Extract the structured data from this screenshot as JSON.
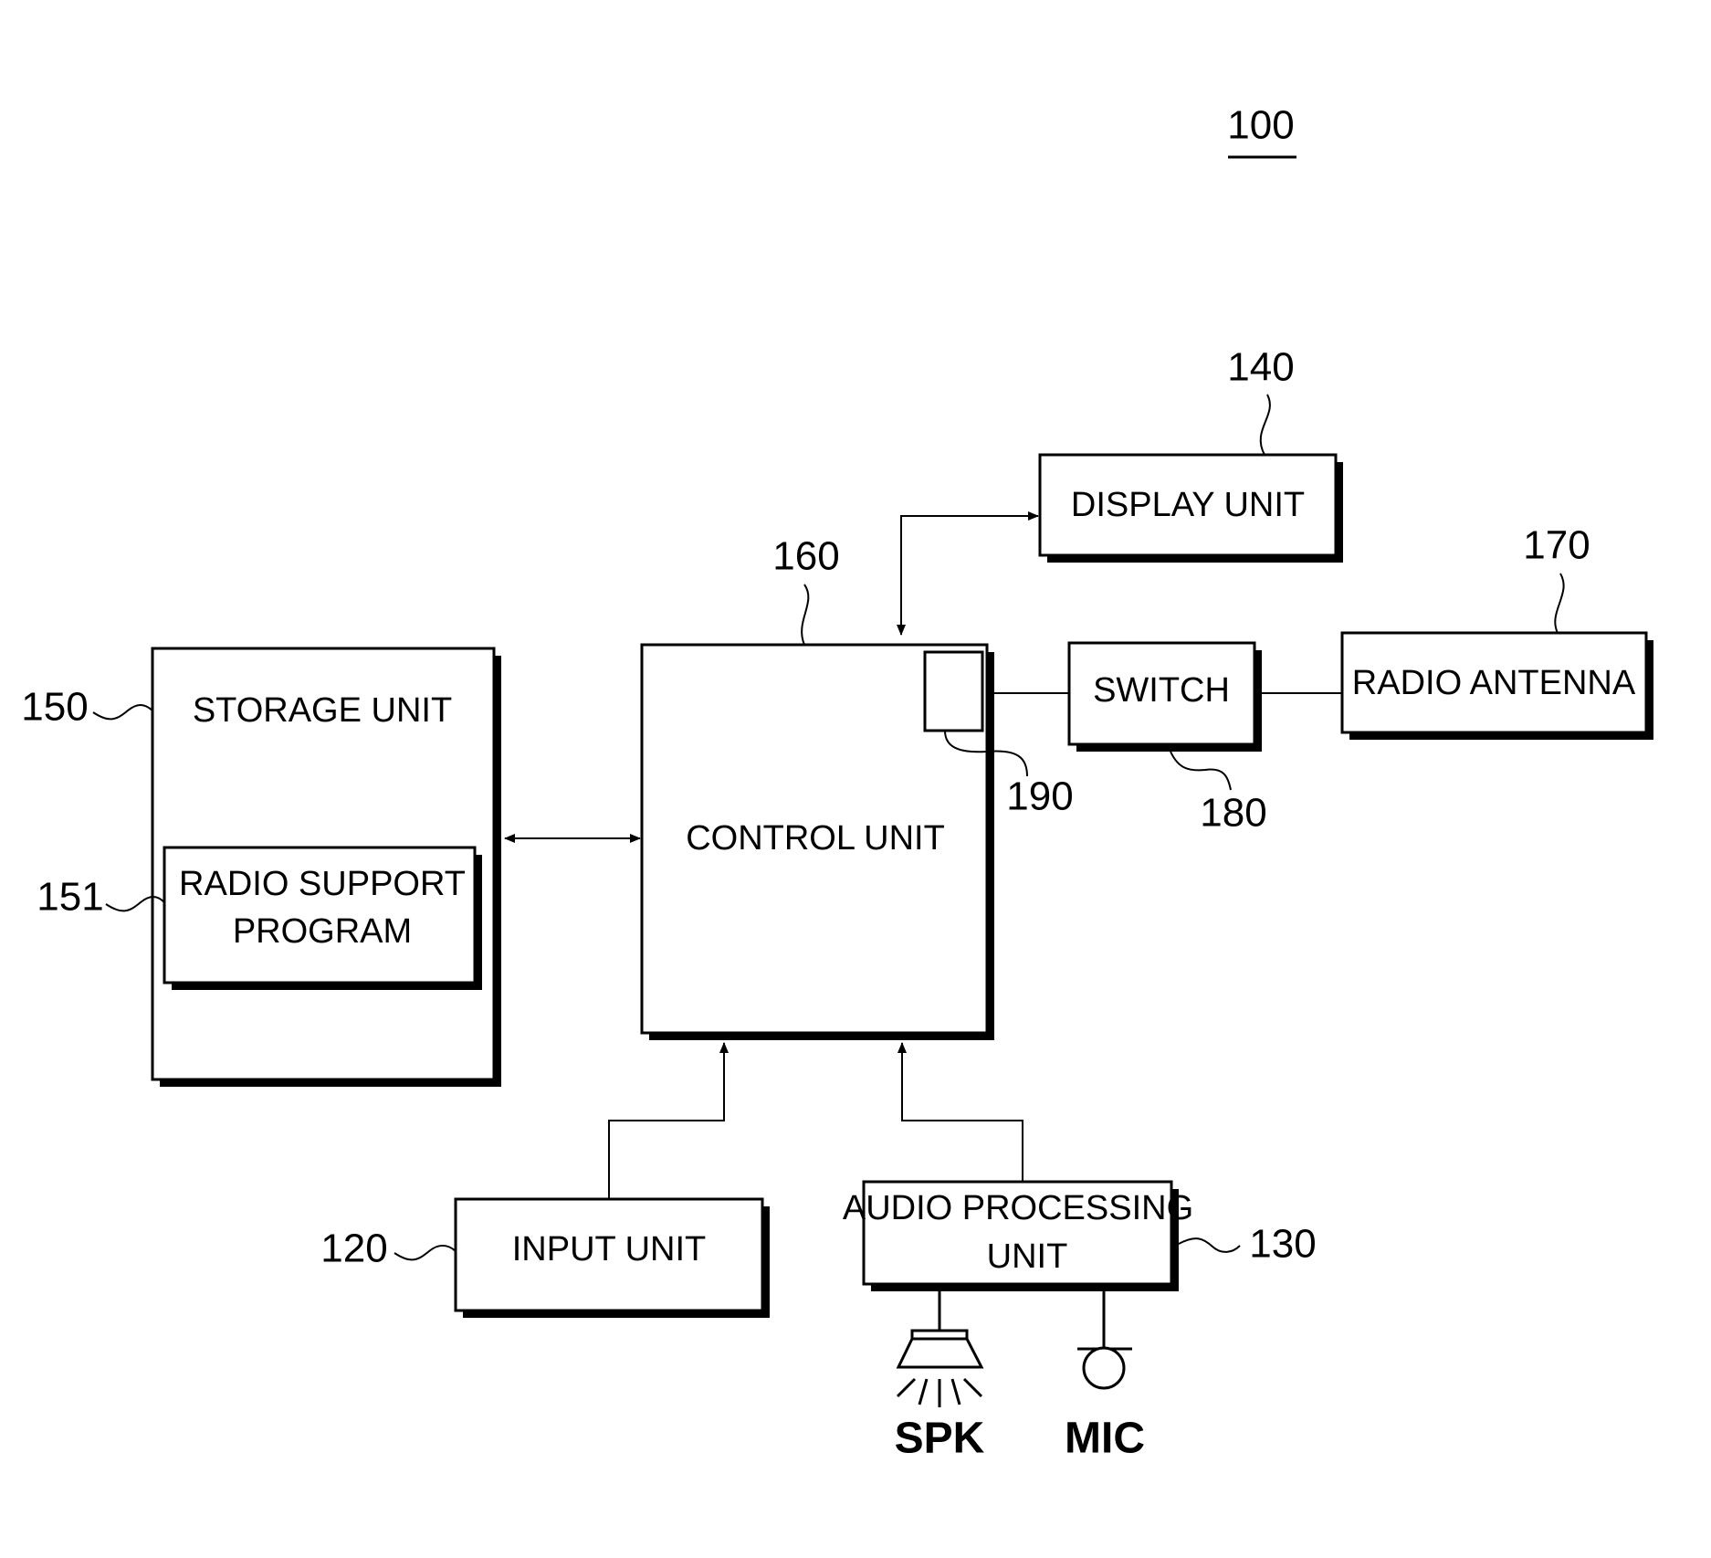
{
  "figure": {
    "ref_main": "100",
    "blocks": {
      "display": {
        "label": "DISPLAY UNIT",
        "ref": "140"
      },
      "control": {
        "label": "CONTROL UNIT",
        "ref": "160"
      },
      "storage": {
        "label": "STORAGE UNIT",
        "ref": "150"
      },
      "radio_program": {
        "line1": "RADIO SUPPORT",
        "line2": "PROGRAM",
        "ref": "151"
      },
      "switch": {
        "label": "SWITCH",
        "ref": "180"
      },
      "antenna": {
        "label": "RADIO ANTENNA",
        "ref": "170"
      },
      "sub_module": {
        "ref": "190"
      },
      "input": {
        "label": "INPUT UNIT",
        "ref": "120"
      },
      "audio": {
        "line1": "AUDIO PROCESSING",
        "line2": "UNIT",
        "ref": "130"
      }
    },
    "peripherals": {
      "speaker": "SPK",
      "mic": "MIC"
    }
  }
}
